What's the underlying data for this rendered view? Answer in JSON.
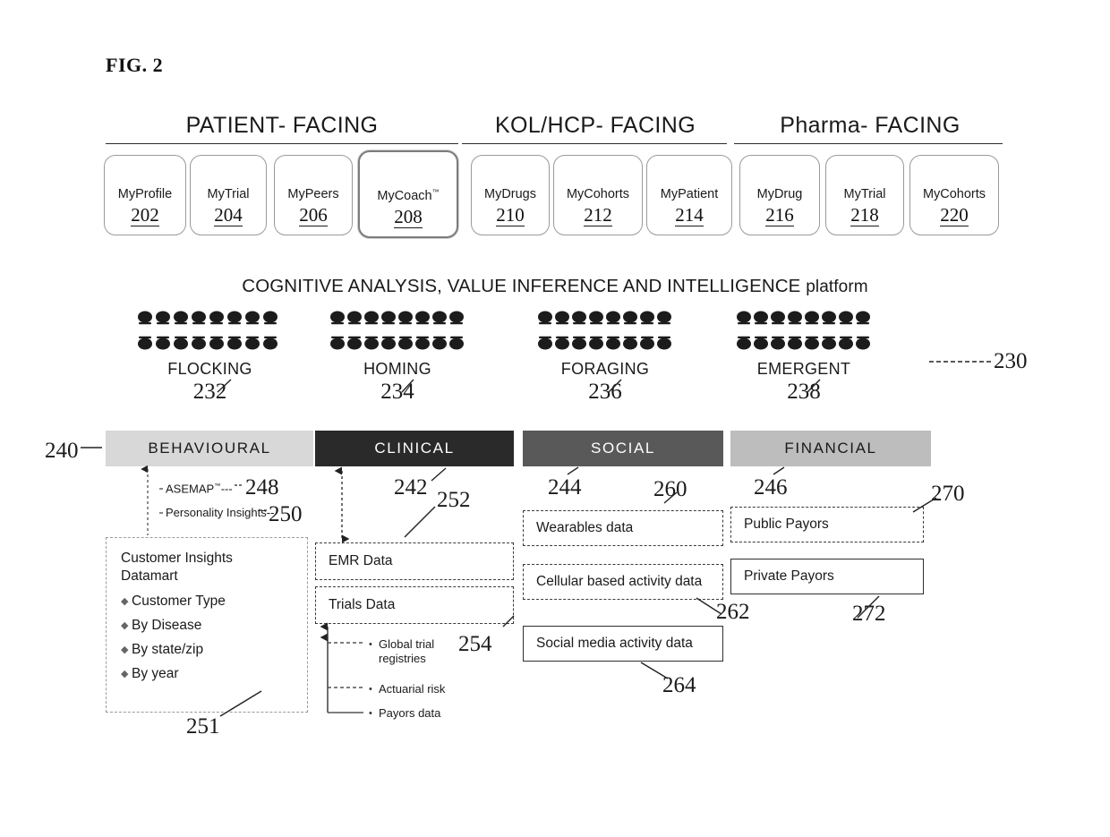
{
  "figure": {
    "title": "FIG. 2"
  },
  "groups": [
    {
      "label": "PATIENT- FACING"
    },
    {
      "label": "KOL/HCP- FACING"
    },
    {
      "label": "Pharma- FACING"
    }
  ],
  "apps": [
    {
      "name": "MyProfile",
      "tm": "",
      "num": "202",
      "emphasis": false
    },
    {
      "name": "MyTrial",
      "tm": "",
      "num": "204",
      "emphasis": false
    },
    {
      "name": "MyPeers",
      "tm": "",
      "num": "206",
      "emphasis": false
    },
    {
      "name": "MyCoach",
      "tm": "™",
      "num": "208",
      "emphasis": true
    },
    {
      "name": "MyDrugs",
      "tm": "",
      "num": "210",
      "emphasis": false
    },
    {
      "name": "MyCohorts",
      "tm": "",
      "num": "212",
      "emphasis": false
    },
    {
      "name": "MyPatient",
      "tm": "",
      "num": "214",
      "emphasis": false
    },
    {
      "name": "MyDrug",
      "tm": "",
      "num": "216",
      "emphasis": false
    },
    {
      "name": "MyTrial",
      "tm": "",
      "num": "218",
      "emphasis": false
    },
    {
      "name": "MyCohorts",
      "tm": "",
      "num": "220",
      "emphasis": false
    }
  ],
  "platform": {
    "text_main": "COGNITIVE ANALYSIS, VALUE INFERENCE AND INTELLIGENCE ",
    "text_suffix": "platform"
  },
  "swarms": {
    "group_ref": "230",
    "items": [
      {
        "label": "FLOCKING",
        "num": "232"
      },
      {
        "label": "HOMING",
        "num": "234"
      },
      {
        "label": "FORAGING",
        "num": "236"
      },
      {
        "label": "EMERGENT",
        "num": "238"
      }
    ]
  },
  "bands": {
    "row_ref": "240",
    "items": [
      {
        "label": "BEHAVIOURAL",
        "num": "",
        "color": "#d8d8d8",
        "text_color": "#1a1a1a"
      },
      {
        "label": "CLINICAL",
        "num": "242",
        "color": "#2a2a2a",
        "text_color": "#ffffff"
      },
      {
        "label": "SOCIAL",
        "num": "244",
        "color": "#595959",
        "text_color": "#ffffff"
      },
      {
        "label": "FINANCIAL",
        "num": "246",
        "color": "#bdbdbd",
        "text_color": "#1a1a1a"
      }
    ]
  },
  "behavioural": {
    "annotations": [
      {
        "text": "ASEMAP",
        "tm": "™",
        "dashes": "---",
        "num": "248"
      },
      {
        "text": "Personality Insights",
        "tm": "",
        "dashes": "--",
        "num": "250"
      }
    ],
    "datamart": {
      "title_line1": "Customer Insights",
      "title_line2": "Datamart",
      "items": [
        "Customer Type",
        "By Disease",
        "By state/zip",
        "By year"
      ],
      "num": "251"
    }
  },
  "clinical": {
    "boxes": [
      {
        "label": "EMR Data",
        "num": "252"
      },
      {
        "label": "Trials Data",
        "num": ""
      }
    ],
    "sublist": {
      "items": [
        "Global trial registries",
        "Actuarial risk",
        "Payors data"
      ],
      "num": "254"
    }
  },
  "social": {
    "boxes": [
      {
        "label": "Wearables data",
        "num": "260"
      },
      {
        "label": "Cellular based activity data",
        "num": "262"
      },
      {
        "label": "Social media activity data",
        "num": "264"
      }
    ]
  },
  "financial": {
    "boxes": [
      {
        "label": "Public Payors",
        "num": "270"
      },
      {
        "label": "Private Payors",
        "num": "272"
      }
    ]
  }
}
